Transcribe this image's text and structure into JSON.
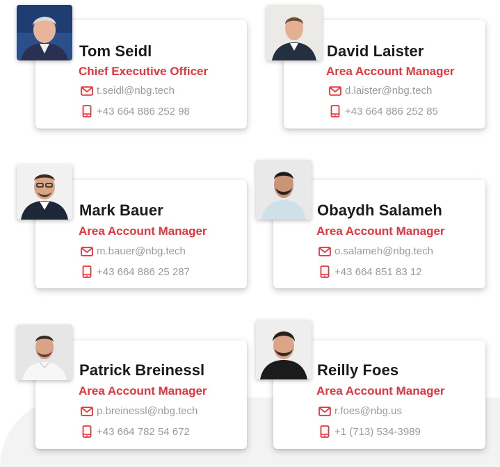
{
  "theme": {
    "accent": "#e8333b",
    "name_color": "#1b1b1b",
    "contact_color": "#9a9a9a"
  },
  "contacts": [
    {
      "name": "Tom Seidl",
      "role": "Chief Executive Officer",
      "email": "t.seidl@nbg.tech",
      "phone": "+43 664 886 252 98",
      "email_icon": "mail-icon",
      "phone_icon": "mobile-phone-icon"
    },
    {
      "name": "David Laister",
      "role": "Area Account Manager",
      "email": "d.laister@nbg.tech",
      "phone": "+43 664 886 252 85",
      "email_icon": "mail-icon",
      "phone_icon": "mobile-phone-icon"
    },
    {
      "name": "Mark Bauer",
      "role": "Area Account Manager",
      "email": "m.bauer@nbg.tech",
      "phone": "+43 664 886 25 287",
      "email_icon": "mail-icon",
      "phone_icon": "mobile-phone-icon"
    },
    {
      "name": "Obaydh Salameh",
      "role": "Area Account Manager",
      "email": "o.salameh@nbg.tech",
      "phone": "+43 664 851 83 12",
      "email_icon": "mail-icon",
      "phone_icon": "mobile-phone-icon"
    },
    {
      "name": "Patrick Breinessl",
      "role": "Area Account Manager",
      "email": "p.breinessl@nbg.tech",
      "phone": "+43 664 782 54 672",
      "email_icon": "mail-icon",
      "phone_icon": "mobile-phone-icon"
    },
    {
      "name": "Reilly Foes",
      "role": "Area Account Manager",
      "email": "r.foes@nbg.us",
      "phone": "+1 (713) 534-3989",
      "email_icon": "mail-icon",
      "phone_icon": "mobile-phone-icon"
    }
  ]
}
